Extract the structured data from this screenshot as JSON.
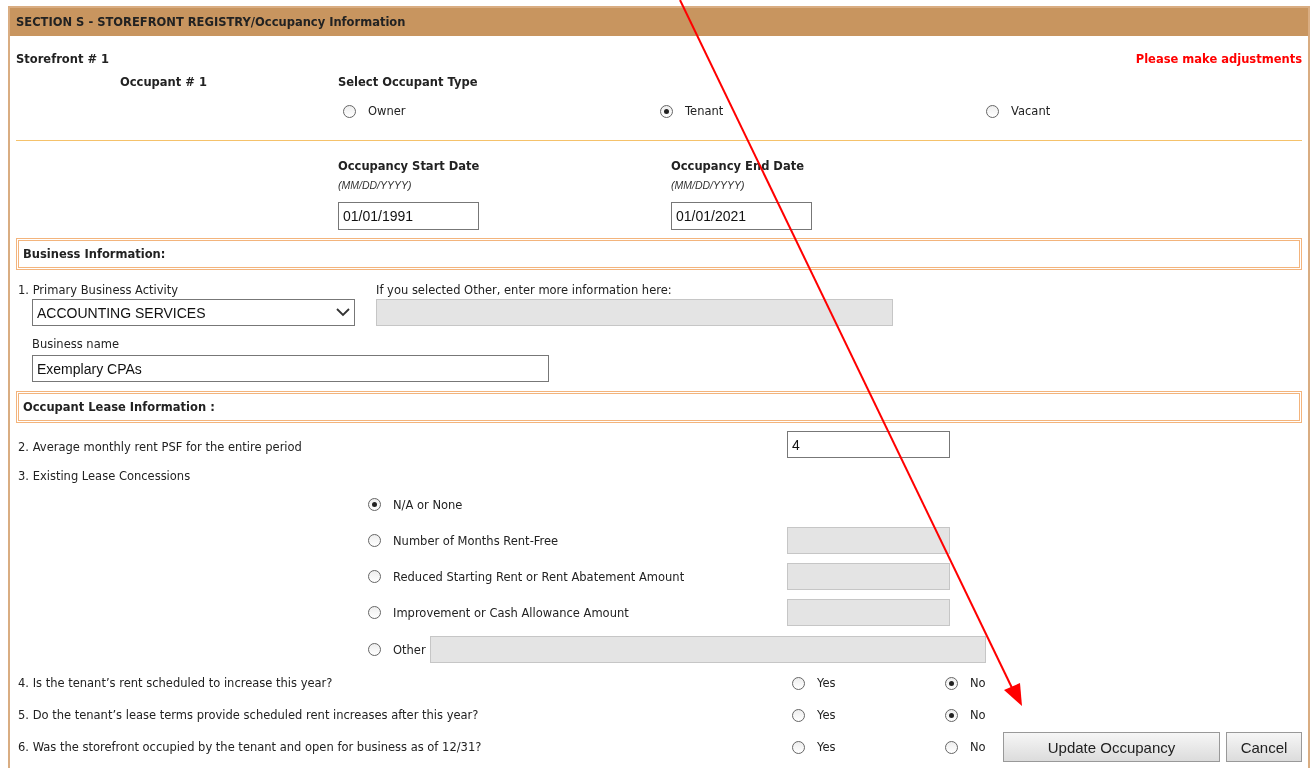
{
  "section_title": "SECTION S - STOREFRONT REGISTRY/Occupancy Information",
  "storefront_label": "Storefront # 1",
  "alert": "Please make adjustments",
  "occupant_label": "Occupant # 1",
  "occupant_type": {
    "label": "Select Occupant Type",
    "options": [
      {
        "label": "Owner",
        "selected": false
      },
      {
        "label": "Tenant",
        "selected": true
      },
      {
        "label": "Vacant",
        "selected": false
      }
    ]
  },
  "dates": [
    {
      "label": "Occupancy Start Date",
      "hint": "(MM/DD/YYYY)",
      "value": "01/01/1991"
    },
    {
      "label": "Occupancy End Date",
      "hint": "(MM/DD/YYYY)",
      "value": "01/01/2021"
    }
  ],
  "business_info": {
    "heading": "Business Information:",
    "activity": {
      "label": "1. Primary Business Activity",
      "value": "ACCOUNTING SERVICES"
    },
    "other": {
      "label": "If you selected Other, enter more information here:",
      "disabled": true
    },
    "name": {
      "label": "Business name",
      "value": "Exemplary CPAs"
    }
  },
  "lease_info": {
    "heading": "Occupant Lease Information :",
    "rent": {
      "label": "2. Average monthly rent PSF for the entire period",
      "value": "4"
    },
    "concessions": {
      "label": "3. Existing Lease Concessions",
      "options": [
        {
          "label": "N/A or None",
          "selected": true,
          "kind": "plain"
        },
        {
          "label": "Number of Months Rent-Free",
          "selected": false,
          "kind": "amount",
          "disabled": true
        },
        {
          "label": "Reduced Starting Rent or Rent Abatement Amount",
          "selected": false,
          "kind": "amount",
          "disabled": true
        },
        {
          "label": "Improvement or Cash Allowance Amount",
          "selected": false,
          "kind": "amount",
          "disabled": true
        },
        {
          "label": "Other",
          "selected": false,
          "kind": "other",
          "disabled": true
        }
      ]
    }
  },
  "questions": [
    {
      "label": "4. Is the tenant’s rent scheduled to increase this year?",
      "options": [
        {
          "label": "Yes",
          "selected": false
        },
        {
          "label": "No",
          "selected": true
        }
      ]
    },
    {
      "label": "5. Do the tenant’s lease terms provide scheduled rent increases after this year?",
      "options": [
        {
          "label": "Yes",
          "selected": false
        },
        {
          "label": "No",
          "selected": true
        }
      ]
    },
    {
      "label": "6. Was the storefront occupied by the tenant and open for business as of 12/31?",
      "options": [
        {
          "label": "Yes",
          "selected": false
        },
        {
          "label": "No",
          "selected": false
        }
      ]
    }
  ],
  "buttons": [
    "Update Occupancy",
    "Cancel"
  ]
}
